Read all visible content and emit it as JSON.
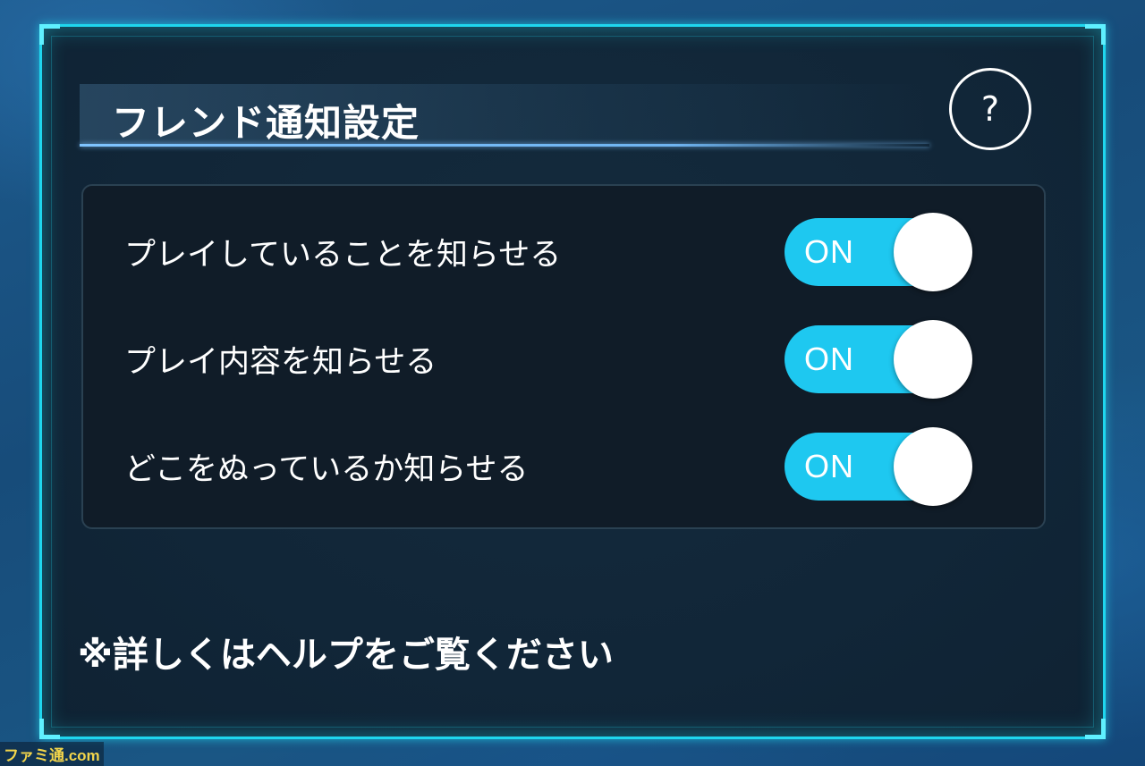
{
  "dialog": {
    "title": "フレンド通知設定",
    "help_label": "?",
    "settings": [
      {
        "label": "プレイしていることを知らせる",
        "toggle_text": "ON",
        "state": "on"
      },
      {
        "label": "プレイ内容を知らせる",
        "toggle_text": "ON",
        "state": "on"
      },
      {
        "label": "どこをぬっているか知らせる",
        "toggle_text": "ON",
        "state": "on"
      }
    ],
    "footnote": "※詳しくはヘルプをご覧ください"
  },
  "watermark": "ファミ通.com",
  "colors": {
    "frame": "#1fd6ee",
    "toggle_on": "#1ec8f0",
    "panel_bg": "#101c28"
  }
}
